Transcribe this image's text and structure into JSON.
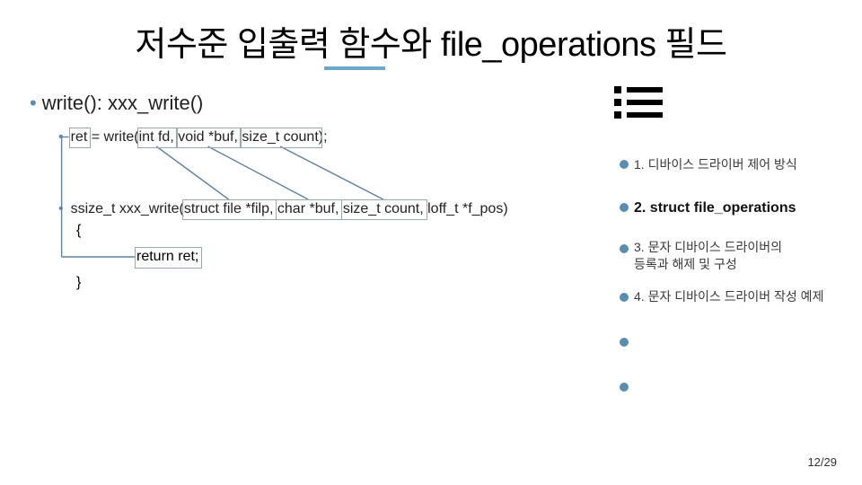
{
  "title": "저수준 입출력 함수와 file_operations 필드",
  "main_bullet": "write(): xxx_write()",
  "line1": {
    "prefix": "",
    "ret": "ret",
    "eq": " = write(",
    "p1": "int fd,",
    "sp1": " ",
    "p2": "void *buf,",
    "sp2": " ",
    "p3": "size_t count",
    "close": ");"
  },
  "line2": {
    "sig_a": "ssize_t xxx_write(",
    "p1": "struct file *filp,",
    "sp1": " ",
    "p2": "char *buf,",
    "sp2": " ",
    "p3": "size_t count,",
    "rest": " loff_t *f_pos)"
  },
  "brace_open": "{",
  "return_stmt": "return ret;",
  "brace_close": "}",
  "outline": [
    "1. 디바이스 드라이버 제어 방식",
    "2. struct file_operations",
    "3. 문자 디바이스 드라이버의\n등록과 해제 및 구성",
    "4. 문자 디바이스 드라이버 작성 예제"
  ],
  "page": "12/29"
}
